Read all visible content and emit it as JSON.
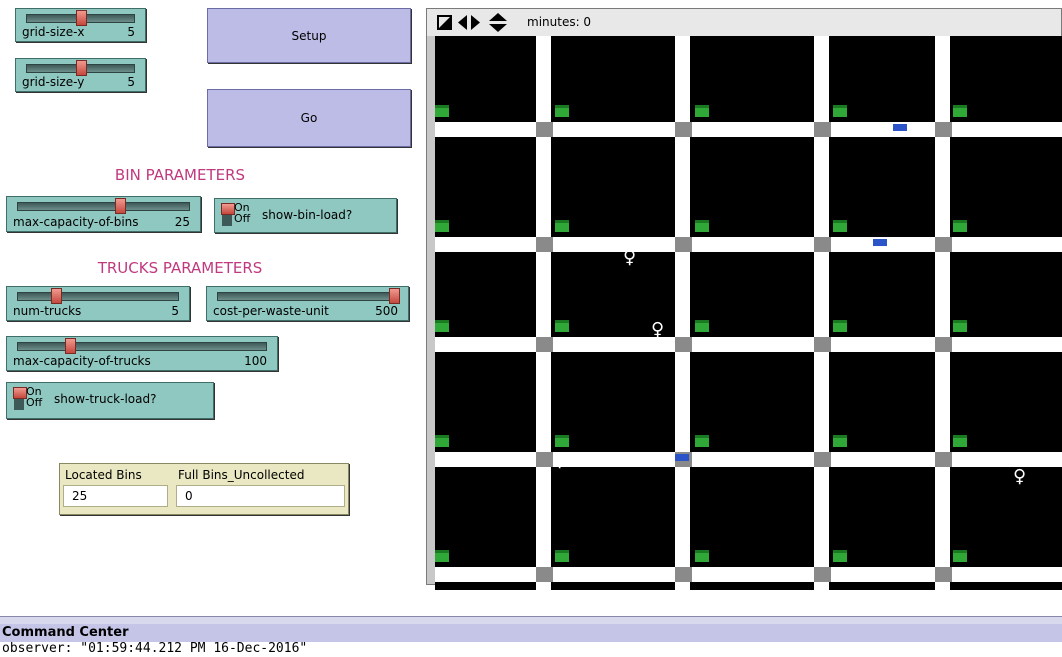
{
  "sliders": {
    "grid_size_x": {
      "label": "grid-size-x",
      "value": "5",
      "fraction": 0.5
    },
    "grid_size_y": {
      "label": "grid-size-y",
      "value": "5",
      "fraction": 0.5
    },
    "max_capacity_of_bins": {
      "label": "max-capacity-of-bins",
      "value": "25",
      "fraction": 0.6
    },
    "num_trucks": {
      "label": "num-trucks",
      "value": "5",
      "fraction": 0.22
    },
    "cost_per_waste_unit": {
      "label": "cost-per-waste-unit",
      "value": "500",
      "fraction": 1.0
    },
    "max_capacity_of_trucks": {
      "label": "max-capacity-of-trucks",
      "value": "100",
      "fraction": 0.2
    }
  },
  "buttons": {
    "setup": "Setup",
    "go": "Go"
  },
  "headings": {
    "bin": "BIN PARAMETERS",
    "trucks": "TRUCKS PARAMETERS"
  },
  "switches": {
    "show_bin_load": {
      "label": "show-bin-load?",
      "on": "On",
      "off": "Off",
      "state": "off"
    },
    "show_truck_load": {
      "label": "show-truck-load?",
      "on": "On",
      "off": "Off",
      "state": "off"
    }
  },
  "monitors": {
    "located_bins": {
      "label": "Located Bins",
      "value": "25"
    },
    "full_bins": {
      "label": "Full Bins_Uncollected",
      "value": "0"
    }
  },
  "view": {
    "ticks": "minutes: 0"
  },
  "command_center": {
    "title": "Command Center",
    "output": "observer: \"01:59:44.212 PM 16-Dec-2016\""
  },
  "colors": {
    "slider": "#8fc8c0",
    "button": "#bcbce6",
    "heading": "#c0397e",
    "monitor": "#eae8c2",
    "bin": "#2fa838",
    "truck": "#2b54c8"
  },
  "icons": [
    "zoom-icon",
    "horizontal-arrows-icon",
    "vertical-arrows-icon",
    "bin-icon",
    "truck-icon",
    "person-icon"
  ]
}
